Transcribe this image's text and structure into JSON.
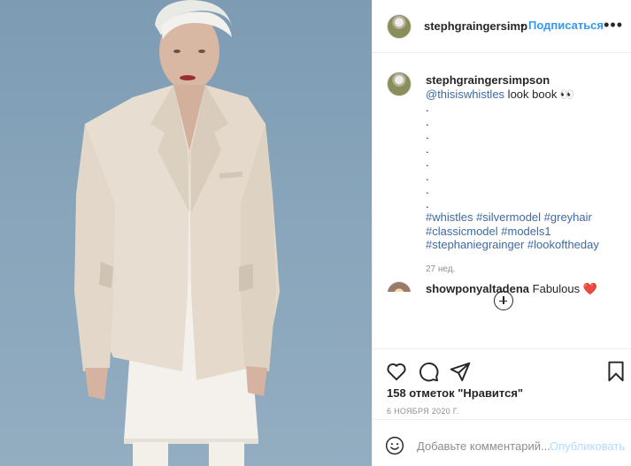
{
  "header": {
    "username": "stephgraingersimp",
    "separator": "•",
    "follow_label": "Подписаться",
    "more_label": "•••"
  },
  "caption": {
    "username": "stephgraingersimpson",
    "mention": "@thisiswhistles",
    "text": " look book 👀",
    "dots": [
      ".",
      ".",
      ".",
      ".",
      ".",
      ".",
      ".",
      "."
    ],
    "hashtags_line1": "#whistles #silvermodel #greyhair",
    "hashtags_line2": "#classicmodel #models1",
    "hashtags_line3": "#stephaniegrainger #lookoftheday",
    "time_ago": "27 нед."
  },
  "comment": {
    "username": "showponyaltadena",
    "text": "Fabulous",
    "emoji": "❤️"
  },
  "actions": {
    "likes": "158 отметок \"Нравится\"",
    "date": "6 НОЯБРЯ 2020 Г."
  },
  "add_comment": {
    "placeholder": "Добавьте комментарий...",
    "publish_label": "Опубликовать"
  },
  "colors": {
    "accent": "#3897f0",
    "hashtag": "#3e6aa3",
    "photo_background": "#88a5bb",
    "blazer": "#e7ddd0"
  },
  "icons": {
    "like": "heart-icon",
    "comment": "comment-icon",
    "share": "share-icon",
    "save": "bookmark-icon",
    "emoji": "smile-icon",
    "load_more": "plus-circle-icon"
  }
}
